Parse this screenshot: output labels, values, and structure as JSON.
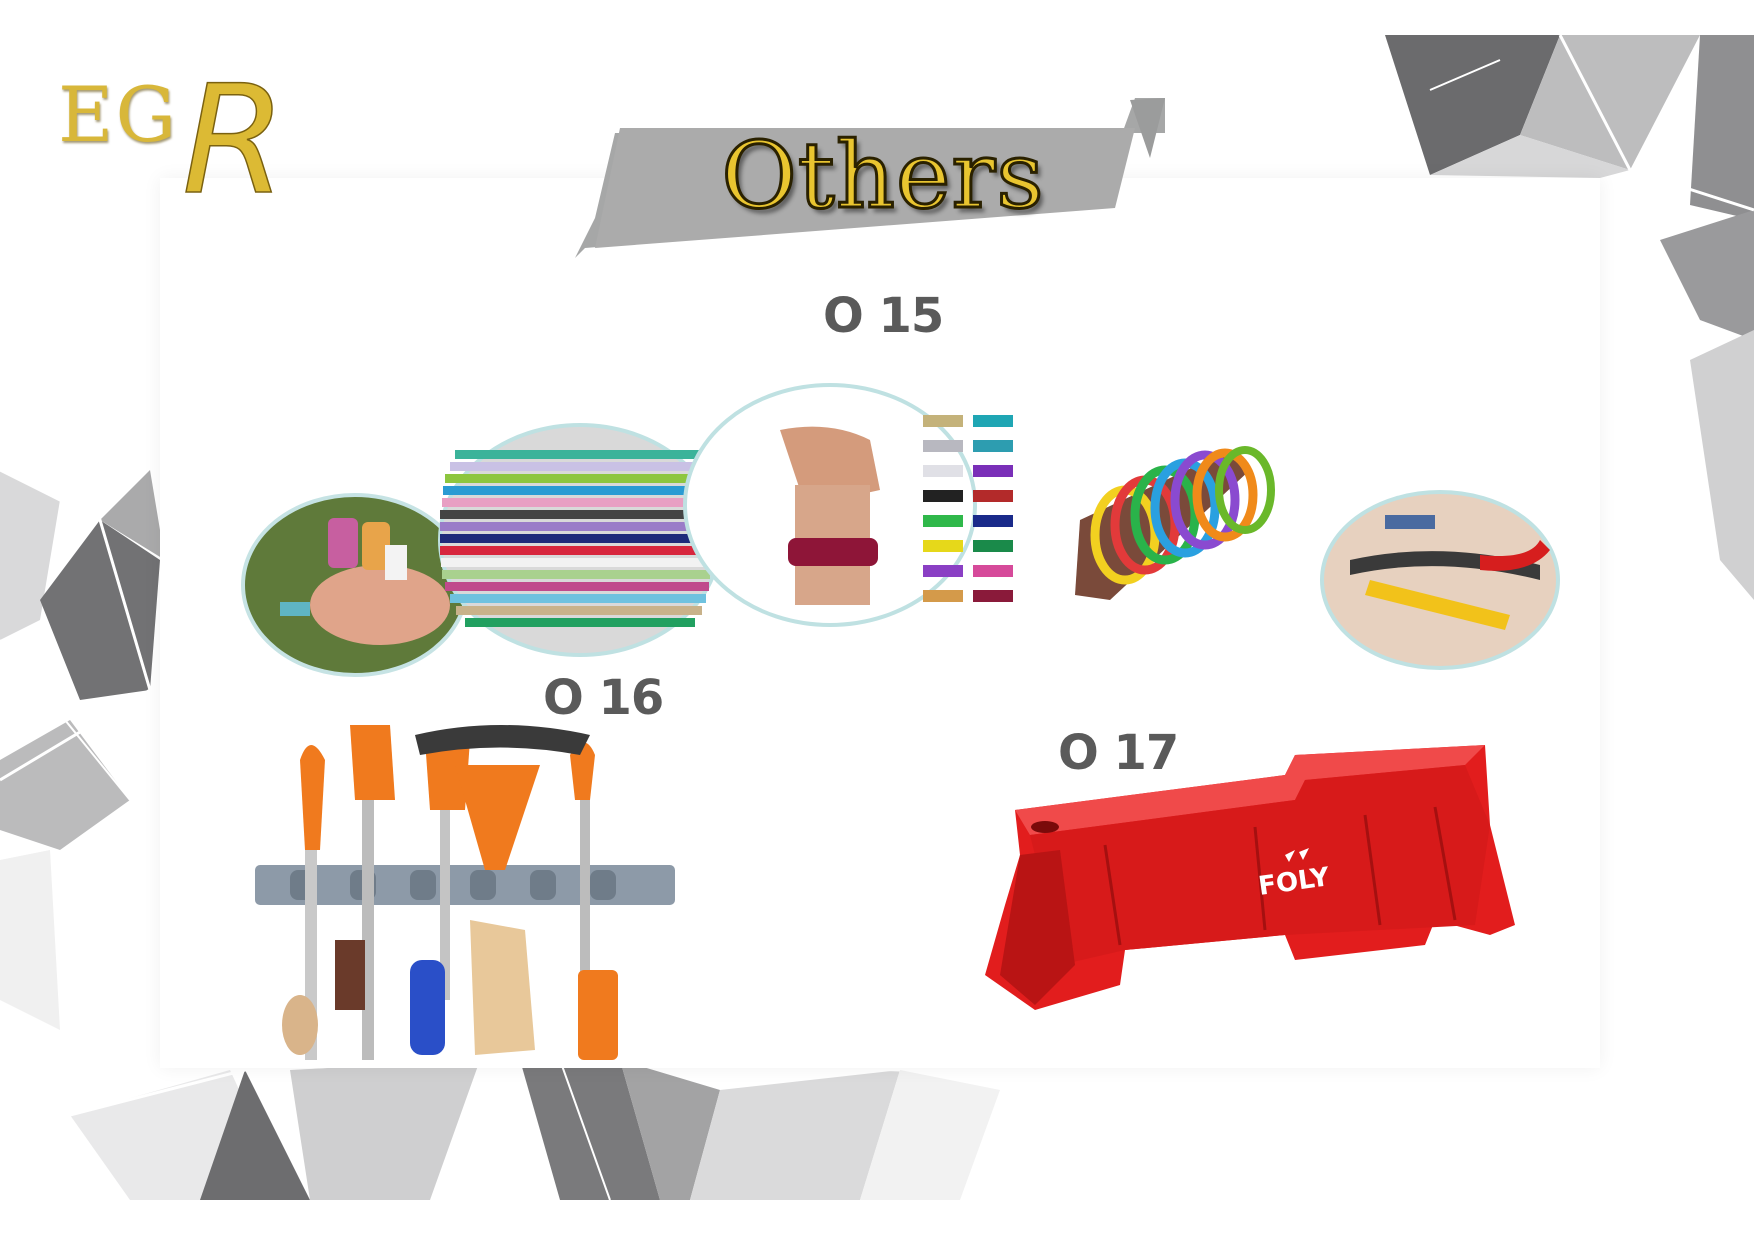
{
  "brand": {
    "logo_text": "EG",
    "logo_letter": "R"
  },
  "page": {
    "title": "Others"
  },
  "products": [
    {
      "code": "O 15",
      "name": "wristbands"
    },
    {
      "code": "O 16",
      "name": "mop and broom holder"
    },
    {
      "code": "O 17",
      "name": "road barrier",
      "brand_print": "FOLY"
    }
  ],
  "colors": {
    "gold": "#e0bd2e",
    "banner_gray": "#a9aaaa",
    "geo_dark": "#6e6e70",
    "barrier_red": "#e21d1d",
    "tool_orange": "#f07a1e"
  }
}
